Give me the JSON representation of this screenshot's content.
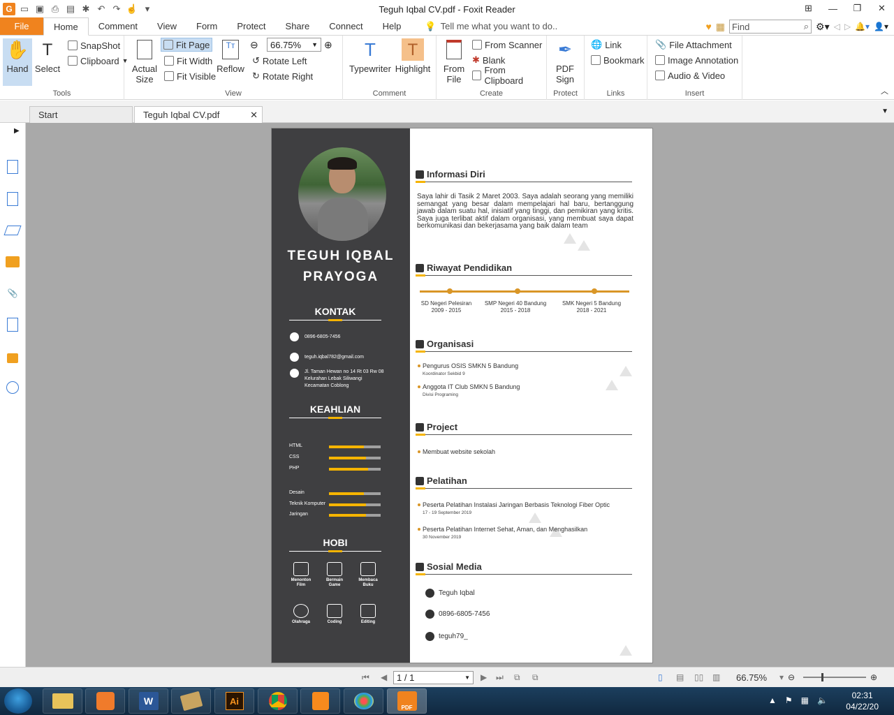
{
  "window": {
    "title": "Teguh Iqbal CV.pdf - Foxit Reader",
    "min_icon": "minimize-icon",
    "max_icon": "maximize-icon",
    "close_icon": "close-icon"
  },
  "menu": {
    "file": "File",
    "tabs": [
      "Home",
      "Comment",
      "View",
      "Form",
      "Protect",
      "Share",
      "Connect",
      "Help"
    ],
    "tell_me": "Tell me what you want to do..",
    "find_placeholder": "Find"
  },
  "ribbon": {
    "tools": {
      "label": "Tools",
      "hand": "Hand",
      "select": "Select",
      "snapshot": "SnapShot",
      "clipboard": "Clipboard"
    },
    "view": {
      "label": "View",
      "actual_size": "Actual Size",
      "fit_page": "Fit Page",
      "fit_width": "Fit Width",
      "fit_visible": "Fit Visible",
      "reflow": "Reflow",
      "zoom": "66.75%",
      "rotate_left": "Rotate Left",
      "rotate_right": "Rotate Right"
    },
    "comment": {
      "label": "Comment",
      "typewriter": "Typewriter",
      "highlight": "Highlight"
    },
    "create": {
      "label": "Create",
      "from_file": "From File",
      "from_scanner": "From Scanner",
      "blank": "Blank",
      "from_clipboard": "From Clipboard"
    },
    "protect": {
      "label": "Protect",
      "pdf_sign": "PDF Sign"
    },
    "links": {
      "label": "Links",
      "link": "Link",
      "bookmark": "Bookmark"
    },
    "insert": {
      "label": "Insert",
      "file_attachment": "File Attachment",
      "image_annotation": "Image Annotation",
      "audio_video": "Audio & Video"
    }
  },
  "doc_tabs": [
    "Start",
    "Teguh Iqbal CV.pdf"
  ],
  "cv": {
    "name_line1": "TEGUH IQBAL",
    "name_line2": "PRAYOGA",
    "kontak_title": "KONTAK",
    "phone": "0896-6805-7456",
    "email": "teguh.iqbal782@gmail.com",
    "address": [
      "Jl. Taman Hewan no 14 Rt 03 Rw 08",
      "Kelurahan Lebak Siliwangi",
      "Kecamatan Coblong"
    ],
    "keahlian_title": "KEAHLIAN",
    "skills": [
      {
        "name": "HTML",
        "level": 0.68
      },
      {
        "name": "CSS",
        "level": 0.72
      },
      {
        "name": "PHP",
        "level": 0.75
      },
      {
        "name": "Desain",
        "level": 0.68
      },
      {
        "name": "Teknik Komputer",
        "level": 0.72
      },
      {
        "name": "Jaringan",
        "level": 0.72
      }
    ],
    "hobi_title": "HOBI",
    "hobi": [
      [
        "Menonton",
        "Film"
      ],
      [
        "Bermain",
        "Game"
      ],
      [
        "Membaca",
        "Buku"
      ],
      [
        "Olahraga",
        ""
      ],
      [
        "Coding",
        ""
      ],
      [
        "Editing",
        ""
      ]
    ],
    "info_title": "Informasi Diri",
    "info_text": "Saya lahir di Tasik 2 Maret 2003. Saya adalah seorang yang memiliki semangat yang besar dalam mempelajari hal baru, bertanggung jawab dalam suatu hal, inisiatif yang tinggi, dan pemikiran yang kritis. Saya juga terlibat aktif dalam organisasi, yang membuat saya dapat berkomunikasi dan bekerjasama yang baik dalam team",
    "pendidikan_title": "Riwayat Pendidikan",
    "pendidikan": [
      {
        "school": "SD Negeri Pelesiran",
        "years": "2009 - 2015"
      },
      {
        "school": "SMP Negeri 40 Bandung",
        "years": "2015 - 2018"
      },
      {
        "school": "SMK Negeri 5 Bandung",
        "years": "2018 - 2021"
      }
    ],
    "organisasi_title": "Organisasi",
    "organisasi": [
      {
        "title": "Pengurus OSIS SMKN 5 Bandung",
        "sub": "Koordinator Sekbid 9"
      },
      {
        "title": "Anggota IT Club SMKN 5 Bandung",
        "sub": "Divisi Programing"
      }
    ],
    "project_title": "Project",
    "project": "Membuat website sekolah",
    "pelatihan_title": "Pelatihan",
    "pelatihan": [
      {
        "title": "Peserta Pelatihan Instalasi Jaringan Berbasis Teknologi Fiber Optic",
        "date": "17 - 19 September 2019"
      },
      {
        "title": "Peserta Pelatihan Internet Sehat, Aman, dan Menghasilkan",
        "date": "30 November 2019"
      }
    ],
    "sosmed_title": "Sosial Media",
    "sosmed": [
      "Teguh Iqbal",
      "0896-6805-7456",
      "teguh79_"
    ]
  },
  "status": {
    "page": "1 / 1",
    "zoom": "66.75%"
  },
  "taskbar": {
    "clock_time": "02:31",
    "clock_date": "04/22/20",
    "apps": [
      "Windows Explorer",
      "XAMPP",
      "Word",
      "Tool",
      "Illustrator",
      "Chrome",
      "Sublime",
      "Paint",
      "Foxit Reader"
    ],
    "ai_label": "Ai",
    "word_label": "W",
    "foxit_label": "PDF"
  },
  "colors": {
    "accent": "#f0831e",
    "cv_dark": "#3f3f41",
    "cv_yellow": "#f5b400"
  }
}
